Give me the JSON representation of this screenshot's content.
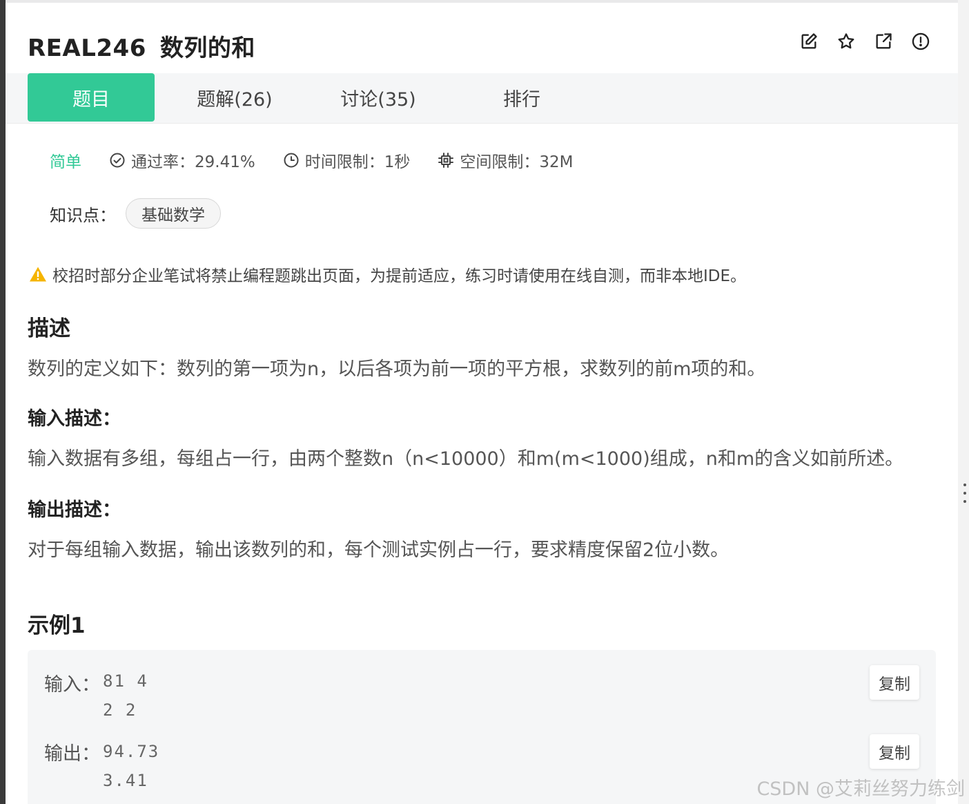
{
  "problem": {
    "id": "REAL246",
    "title": "数列的和"
  },
  "header_icons": [
    "edit-icon",
    "star-icon",
    "share-icon",
    "report-icon"
  ],
  "tabs": [
    {
      "label": "题目",
      "active": true
    },
    {
      "label": "题解(26)",
      "active": false
    },
    {
      "label": "讨论(35)",
      "active": false
    },
    {
      "label": "排行",
      "active": false
    }
  ],
  "meta": {
    "difficulty": "简单",
    "pass_rate": "通过率：29.41%",
    "time_limit": "时间限制：1秒",
    "space_limit": "空间限制：32M"
  },
  "knowledge": {
    "label": "知识点：",
    "tags": [
      "基础数学"
    ]
  },
  "warning": "校招时部分企业笔试将禁止编程题跳出页面，为提前适应，练习时请使用在线自测，而非本地IDE。",
  "description": {
    "heading": "描述",
    "text": "数列的定义如下：数列的第一项为n，以后各项为前一项的平方根，求数列的前m项的和。"
  },
  "input_desc": {
    "heading": "输入描述：",
    "text": "输入数据有多组，每组占一行，由两个整数n（n<10000）和m(m<1000)组成，n和m的含义如前所述。"
  },
  "output_desc": {
    "heading": "输出描述：",
    "text": "对于每组输入数据，输出该数列的和，每个测试实例占一行，要求精度保留2位小数。"
  },
  "example": {
    "heading": "示例1",
    "input_label": "输入：",
    "input_value": "81 4\n2 2",
    "output_label": "输出：",
    "output_value": "94.73\n3.41",
    "copy_label": "复制"
  },
  "watermark": "CSDN @艾莉丝努力练剑",
  "colors": {
    "accent": "#32c996",
    "warning": "#f5b400",
    "tab_bar_bg": "#f5f6f7"
  }
}
